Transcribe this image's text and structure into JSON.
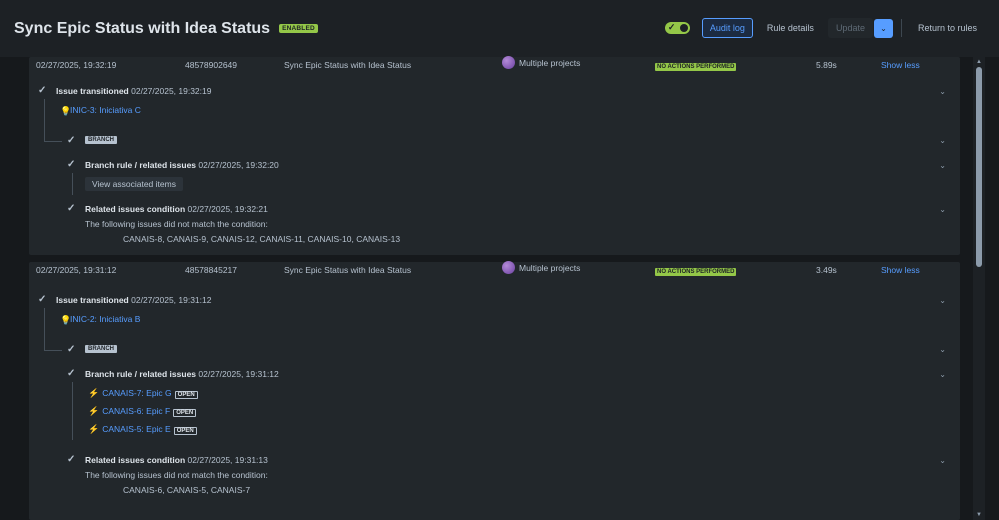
{
  "header": {
    "title": "Sync Epic Status with Idea Status",
    "status_badge": "ENABLED",
    "audit_log": "Audit log",
    "rule_details": "Rule details",
    "update": "Update",
    "return": "Return to rules"
  },
  "entries": [
    {
      "date": "02/27/2025, 19:32:19",
      "id": "48578902649",
      "rule": "Sync Epic Status with Idea Status",
      "scope": "Multiple projects",
      "status": "NO ACTIONS PERFORMED",
      "duration": "5.89s",
      "toggle": "Show less",
      "trigger_label": "Issue transitioned",
      "trigger_time": "02/27/2025, 19:32:19",
      "trigger_issue": "INIC-3: Iniciativa C",
      "branch": "BRANCH",
      "branch_rule_label": "Branch rule / related issues",
      "branch_rule_time": "02/27/2025, 19:32:20",
      "view_items": "View associated items",
      "condition_label": "Related issues condition",
      "condition_time": "02/27/2025, 19:32:21",
      "condition_text": "The following issues did not match the condition:",
      "condition_issues": "CANAIS-8, CANAIS-9, CANAIS-12, CANAIS-11, CANAIS-10, CANAIS-13"
    },
    {
      "date": "02/27/2025, 19:31:12",
      "id": "48578845217",
      "rule": "Sync Epic Status with Idea Status",
      "scope": "Multiple projects",
      "status": "NO ACTIONS PERFORMED",
      "duration": "3.49s",
      "toggle": "Show less",
      "trigger_label": "Issue transitioned",
      "trigger_time": "02/27/2025, 19:31:12",
      "trigger_issue": "INIC-2: Iniciativa B",
      "branch": "BRANCH",
      "branch_rule_label": "Branch rule / related issues",
      "branch_rule_time": "02/27/2025, 19:31:12",
      "related": [
        {
          "key": "CANAIS-7: Epic G",
          "status": "OPEN"
        },
        {
          "key": "CANAIS-6: Epic F",
          "status": "OPEN"
        },
        {
          "key": "CANAIS-5: Epic E",
          "status": "OPEN"
        }
      ],
      "condition_label": "Related issues condition",
      "condition_time": "02/27/2025, 19:31:13",
      "condition_text": "The following issues did not match the condition:",
      "condition_issues": "CANAIS-6, CANAIS-5, CANAIS-7"
    }
  ],
  "colors": {
    "accent": "#579dff",
    "success": "#94c748",
    "background": "#1d2125"
  }
}
